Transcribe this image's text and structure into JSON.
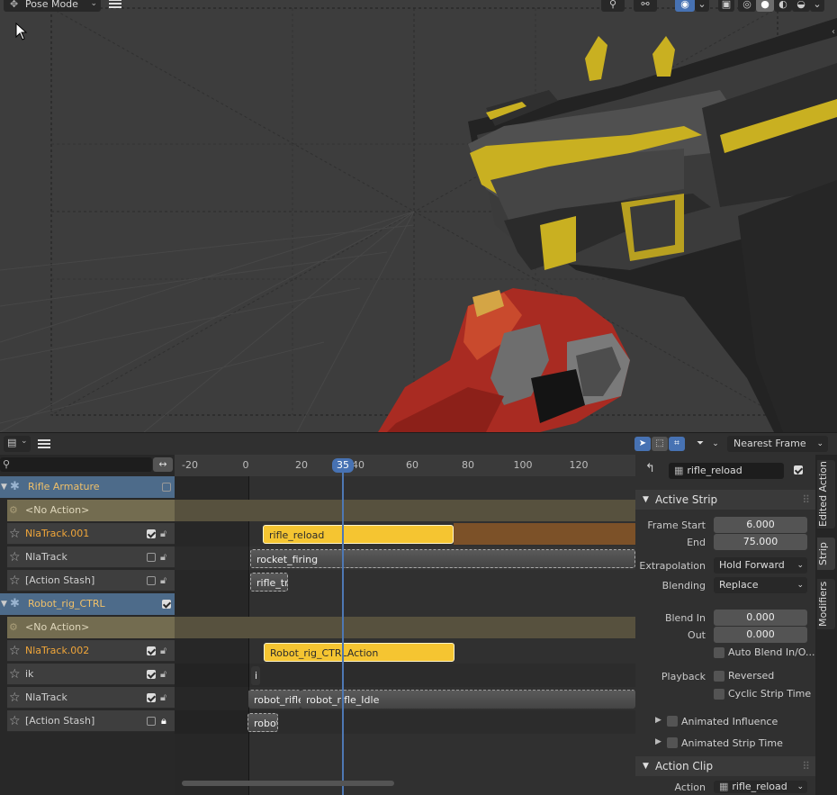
{
  "viewport": {
    "mode_label": "Pose Mode",
    "mode_icon": "pose-mode-icon"
  },
  "nla": {
    "snap_label": "Nearest Frame",
    "ruler": {
      "ticks": [
        "-20",
        "0",
        "20",
        "40",
        "60",
        "80",
        "100",
        "120"
      ],
      "current_frame": "35"
    },
    "channels": [
      {
        "kind": "object",
        "label": "Rifle Armature",
        "checked": false
      },
      {
        "kind": "noaction",
        "label": "<No Action>"
      },
      {
        "kind": "track",
        "label": "NlaTrack.001",
        "orange": true,
        "checked": true,
        "locked": false
      },
      {
        "kind": "track",
        "label": "NlaTrack",
        "orange": false,
        "checked": false,
        "locked": false
      },
      {
        "kind": "track",
        "label": "[Action Stash]",
        "orange": false,
        "checked": false,
        "locked": false
      },
      {
        "kind": "object",
        "label": "Robot_rig_CTRL",
        "checked": true
      },
      {
        "kind": "noaction",
        "label": "<No Action>"
      },
      {
        "kind": "track",
        "label": "NlaTrack.002",
        "orange": true,
        "checked": true,
        "locked": false
      },
      {
        "kind": "track",
        "label": "ik",
        "orange": false,
        "checked": true,
        "locked": false
      },
      {
        "kind": "track",
        "label": "NlaTrack",
        "orange": false,
        "checked": true,
        "locked": false
      },
      {
        "kind": "track",
        "label": "[Action Stash]",
        "orange": false,
        "checked": false,
        "locked": true
      }
    ],
    "strips": {
      "rifle_reload": "rifle_reload",
      "rocket_firing": "rocket_firing",
      "rifle_tran": "rifle_tran",
      "robot_action": "Robot_rig_CTRLAction",
      "ik_strip": "i",
      "robot_rifle_a": "robot_rifle_s",
      "robot_rifle_b": "robot_rifle_Idle",
      "robot_ri": "robot_ri"
    }
  },
  "sidebar": {
    "action_name": "rifle_reload",
    "action_checked": true,
    "active_strip": {
      "header": "Active Strip",
      "frame_start_label": "Frame Start",
      "frame_start": "6.000",
      "end_label": "End",
      "end": "75.000",
      "extrapolation_label": "Extrapolation",
      "extrapolation": "Hold Forward",
      "blending_label": "Blending",
      "blending": "Replace",
      "blend_in_label": "Blend In",
      "blend_in": "0.000",
      "out_label": "Out",
      "out": "0.000",
      "auto_blend_label": "Auto Blend In/O...",
      "playback_label": "Playback",
      "reversed_label": "Reversed",
      "cyclic_label": "Cyclic Strip Time",
      "animated_influence_label": "Animated Influence",
      "animated_strip_time_label": "Animated Strip Time"
    },
    "action_clip": {
      "header": "Action Clip",
      "action_label": "Action",
      "action_value": "rifle_reload"
    }
  },
  "tabs": [
    "Edited Action",
    "Strip",
    "Modifiers"
  ],
  "colors": {
    "accent": "#4772b3",
    "active_strip": "#f5c531",
    "object_row": "#4d6b8a",
    "hold": "#7c5128"
  }
}
